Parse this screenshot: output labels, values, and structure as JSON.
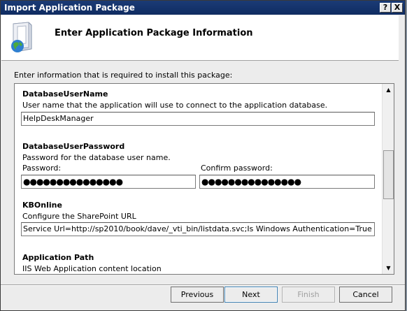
{
  "window": {
    "title": "Import Application Package",
    "help_label": "?",
    "close_label": "X"
  },
  "header": {
    "title": "Enter Application Package Information",
    "icon": "package-globe-icon"
  },
  "intro_text": "Enter information that is required to install this package:",
  "sections": {
    "db_user": {
      "title": "DatabaseUserName",
      "description": "User name that the application will use to connect to the application database.",
      "value": "HelpDeskManager"
    },
    "db_password": {
      "title": "DatabaseUserPassword",
      "description": "Password for the database user name.",
      "password_label": "Password:",
      "confirm_label": "Confirm password:",
      "password_mask": "●●●●●●●●●●●●●●●",
      "confirm_mask": "●●●●●●●●●●●●●●●"
    },
    "kb_online": {
      "title": "KBOnline",
      "description": "Configure the SharePoint URL",
      "value": "Service Url=http://sp2010/book/dave/_vti_bin/listdata.svc;Is Windows Authentication=True"
    },
    "app_path": {
      "title": "Application Path",
      "description": "IIS Web Application content location"
    }
  },
  "scrollbar": {
    "up_icon": "arrow-up-icon",
    "down_icon": "arrow-down-icon"
  },
  "buttons": {
    "previous": "Previous",
    "next": "Next",
    "finish": "Finish",
    "cancel": "Cancel"
  }
}
